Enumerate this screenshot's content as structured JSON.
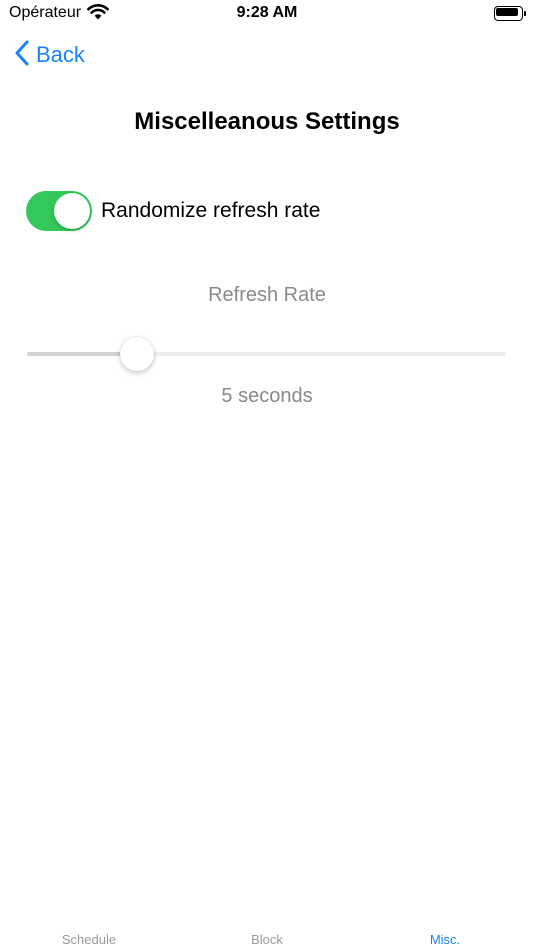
{
  "status_bar": {
    "carrier": "Opérateur",
    "time": "9:28 AM",
    "wifi_icon": "wifi-icon",
    "battery_icon": "battery-icon"
  },
  "nav": {
    "back_label": "Back",
    "back_icon": "chevron-left-icon"
  },
  "page": {
    "title": "Miscelleanous Settings"
  },
  "toggle": {
    "label": "Randomize refresh rate",
    "on": true
  },
  "slider": {
    "title": "Refresh Rate",
    "value_label": "5 seconds",
    "fraction": 0.23
  },
  "tabs": [
    {
      "label": "Schedule",
      "active": false
    },
    {
      "label": "Block",
      "active": false
    },
    {
      "label": "Misc.",
      "active": true
    }
  ],
  "colors": {
    "accent": "#1a82fb",
    "toggle_on": "#34c759",
    "secondary_text": "#8a8a8e"
  }
}
